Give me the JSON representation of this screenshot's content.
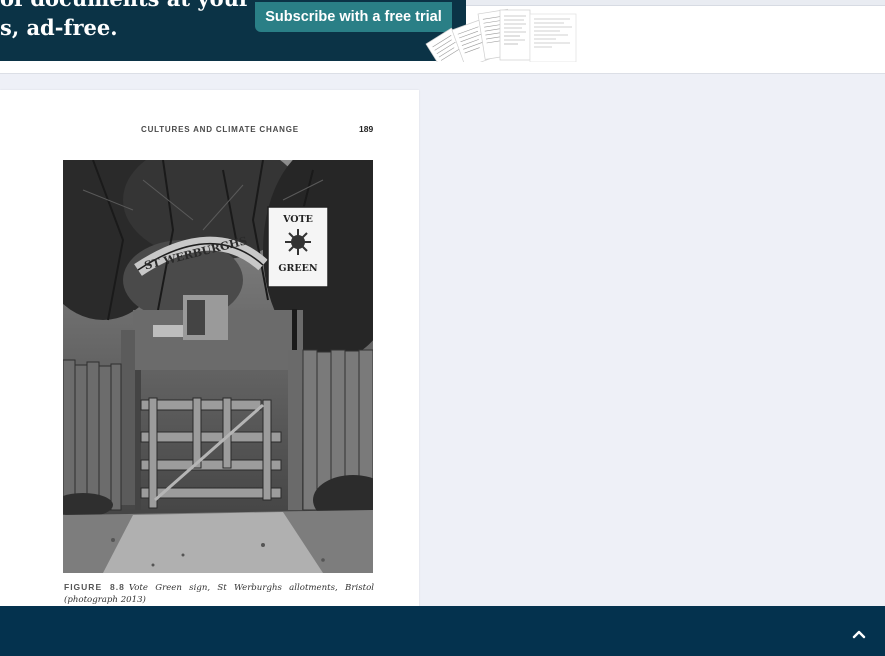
{
  "banner": {
    "line1": "of documents at your",
    "line2": "s, ad-free.",
    "cta_label": "Subscribe with a free trial"
  },
  "page": {
    "running_head": "CULTURES AND CLIMATE CHANGE",
    "page_number": "189",
    "photo": {
      "arch_sign": "ST WERBURGHS",
      "sign_line1": "VOTE",
      "sign_line2": "GREEN"
    },
    "caption": {
      "label": "FIGURE 8.8",
      "text": "Vote Green sign, St Werburghs allotments, Bristol (photograph 2013)"
    }
  },
  "icons": {
    "back_to_top": "chevron-up-icon"
  },
  "colors": {
    "banner_bg": "#0b3346",
    "cta_bg": "#2a7f86",
    "bottom_bar": "#04324e",
    "viewer_bg": "#eef0f7"
  }
}
